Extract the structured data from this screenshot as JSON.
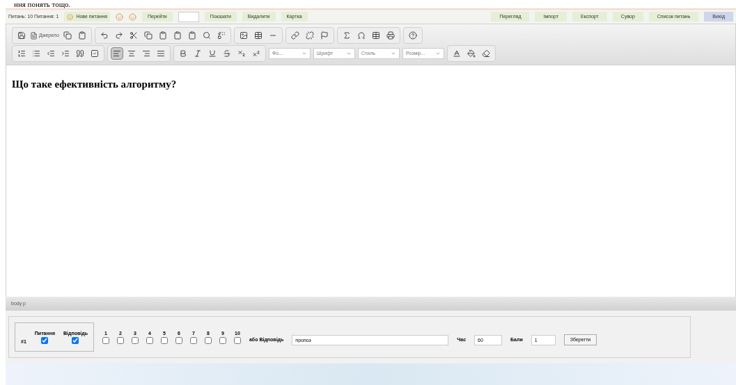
{
  "document_text": "ння понять тощо.",
  "top_bar": {
    "counter": "Питань: 10 Питання: 1",
    "left_buttons": [
      {
        "kind": "icon-text",
        "label": "Нове питання"
      },
      {
        "kind": "icon"
      },
      {
        "kind": "icon"
      },
      {
        "kind": "text",
        "label": "Перейти"
      },
      {
        "kind": "field"
      },
      {
        "kind": "text",
        "label": "Показати"
      },
      {
        "kind": "text",
        "label": "Видалити"
      },
      {
        "kind": "text",
        "label": "Картка"
      }
    ],
    "right_buttons": [
      "Перегляд",
      "Імпорт",
      "Експорт",
      "Сувор",
      "Список питань"
    ],
    "exit_button": "Вихід"
  },
  "toolbar": {
    "source_button": "Джерело",
    "format_dropdowns": [
      "Фо...",
      "Шрифт",
      "Стиль",
      "Розмір..."
    ],
    "align_left_selected": true
  },
  "editor": {
    "question": "Що таке ефективність алгоритму?"
  },
  "status_bar": "body p",
  "answer_panel": {
    "number": "#1",
    "question_label": "Питання",
    "question_checked": true,
    "answer_label": "Відповідь",
    "answer_checked": true,
    "options": [
      {
        "label": "1",
        "checked": false
      },
      {
        "label": "2",
        "checked": false
      },
      {
        "label": "3",
        "checked": false
      },
      {
        "label": "4",
        "checked": false
      },
      {
        "label": "5",
        "checked": false
      },
      {
        "label": "6",
        "checked": false
      },
      {
        "label": "7",
        "checked": false
      },
      {
        "label": "8",
        "checked": false
      },
      {
        "label": "9",
        "checked": false
      },
      {
        "label": "10",
        "checked": false
      }
    ],
    "text_answer_label": "або Відповідь",
    "text_answer_value": "пропоз",
    "time_label": "Час",
    "time_value": "60",
    "points_label": "Бали",
    "points_value": "1",
    "save_button": "Зберегти"
  }
}
